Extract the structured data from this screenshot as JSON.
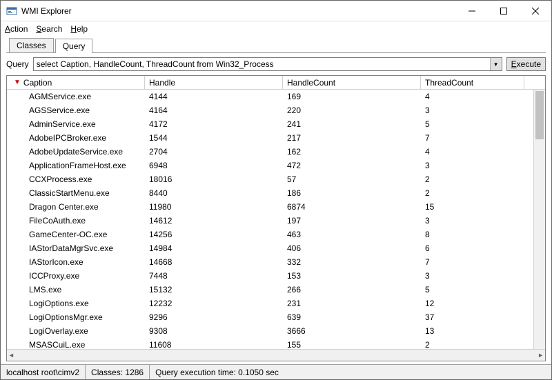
{
  "window": {
    "title": "WMI Explorer"
  },
  "menu": {
    "action": "Action",
    "search": "Search",
    "help": "Help"
  },
  "tabs": {
    "classes": "Classes",
    "query": "Query"
  },
  "query": {
    "label": "Query",
    "text": "select Caption, HandleCount, ThreadCount from Win32_Process",
    "execute": "Execute"
  },
  "columns": {
    "caption": "Caption",
    "handle": "Handle",
    "handleCount": "HandleCount",
    "threadCount": "ThreadCount"
  },
  "rows": [
    {
      "caption": "AGMService.exe",
      "handle": "4144",
      "handleCount": "169",
      "threadCount": "4"
    },
    {
      "caption": "AGSService.exe",
      "handle": "4164",
      "handleCount": "220",
      "threadCount": "3"
    },
    {
      "caption": "AdminService.exe",
      "handle": "4172",
      "handleCount": "241",
      "threadCount": "5"
    },
    {
      "caption": "AdobeIPCBroker.exe",
      "handle": "1544",
      "handleCount": "217",
      "threadCount": "7"
    },
    {
      "caption": "AdobeUpdateService.exe",
      "handle": "2704",
      "handleCount": "162",
      "threadCount": "4"
    },
    {
      "caption": "ApplicationFrameHost.exe",
      "handle": "6948",
      "handleCount": "472",
      "threadCount": "3"
    },
    {
      "caption": "CCXProcess.exe",
      "handle": "18016",
      "handleCount": "57",
      "threadCount": "2"
    },
    {
      "caption": "ClassicStartMenu.exe",
      "handle": "8440",
      "handleCount": "186",
      "threadCount": "2"
    },
    {
      "caption": "Dragon Center.exe",
      "handle": "11980",
      "handleCount": "6874",
      "threadCount": "15"
    },
    {
      "caption": "FileCoAuth.exe",
      "handle": "14612",
      "handleCount": "197",
      "threadCount": "3"
    },
    {
      "caption": "GameCenter-OC.exe",
      "handle": "14256",
      "handleCount": "463",
      "threadCount": "8"
    },
    {
      "caption": "IAStorDataMgrSvc.exe",
      "handle": "14984",
      "handleCount": "406",
      "threadCount": "6"
    },
    {
      "caption": "IAStorIcon.exe",
      "handle": "14668",
      "handleCount": "332",
      "threadCount": "7"
    },
    {
      "caption": "ICCProxy.exe",
      "handle": "7448",
      "handleCount": "153",
      "threadCount": "3"
    },
    {
      "caption": "LMS.exe",
      "handle": "15132",
      "handleCount": "266",
      "threadCount": "5"
    },
    {
      "caption": "LogiOptions.exe",
      "handle": "12232",
      "handleCount": "231",
      "threadCount": "12"
    },
    {
      "caption": "LogiOptionsMgr.exe",
      "handle": "9296",
      "handleCount": "639",
      "threadCount": "37"
    },
    {
      "caption": "LogiOverlay.exe",
      "handle": "9308",
      "handleCount": "3666",
      "threadCount": "13"
    },
    {
      "caption": "MSASCuiL.exe",
      "handle": "11608",
      "handleCount": "155",
      "threadCount": "2"
    }
  ],
  "status": {
    "path": "localhost  root\\cimv2",
    "classes_label": "Classes:",
    "classes_count": "1286",
    "exec_label": "Query execution time:",
    "exec_time": "0.1050 sec"
  }
}
